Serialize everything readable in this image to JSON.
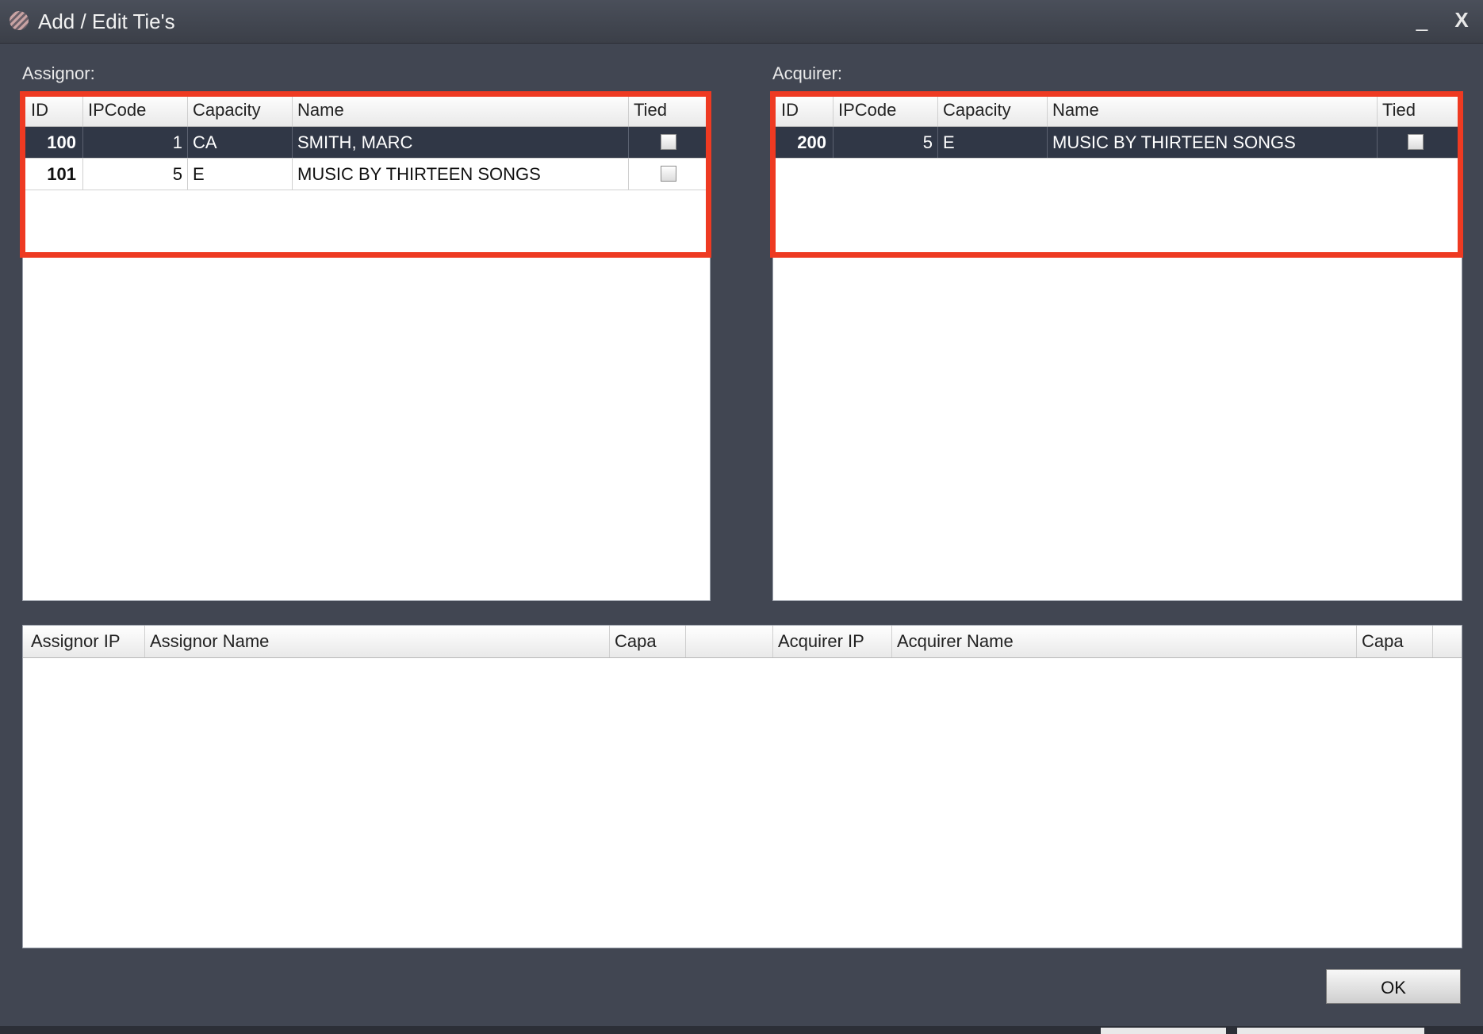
{
  "window": {
    "title": "Add / Edit Tie's",
    "minimize_glyph": "_",
    "close_glyph": "X",
    "icon": "app-logo-icon"
  },
  "assignor": {
    "label": "Assignor:",
    "columns": [
      "ID",
      "IPCode",
      "Capacity",
      "Name",
      "Tied"
    ],
    "rows": [
      {
        "id": "100",
        "ipcode": "1",
        "capacity": "CA",
        "name": "SMITH, MARC",
        "tied": false,
        "selected": true
      },
      {
        "id": "101",
        "ipcode": "5",
        "capacity": "E",
        "name": "MUSIC BY THIRTEEN SONGS",
        "tied": false,
        "selected": false
      }
    ]
  },
  "acquirer": {
    "label": "Acquirer:",
    "columns": [
      "ID",
      "IPCode",
      "Capacity",
      "Name",
      "Tied"
    ],
    "rows": [
      {
        "id": "200",
        "ipcode": "5",
        "capacity": "E",
        "name": "MUSIC BY THIRTEEN SONGS",
        "tied": false,
        "selected": true
      }
    ]
  },
  "ties": {
    "columns": [
      "Assignor IP",
      "Assignor Name",
      "Capa",
      "",
      "Acquirer IP",
      "Acquirer Name",
      "Capa",
      ""
    ]
  },
  "footer": {
    "ok_label": "OK"
  },
  "colors": {
    "highlight": "#ee3a22",
    "selected_row": "#303746",
    "background": "#414652"
  }
}
